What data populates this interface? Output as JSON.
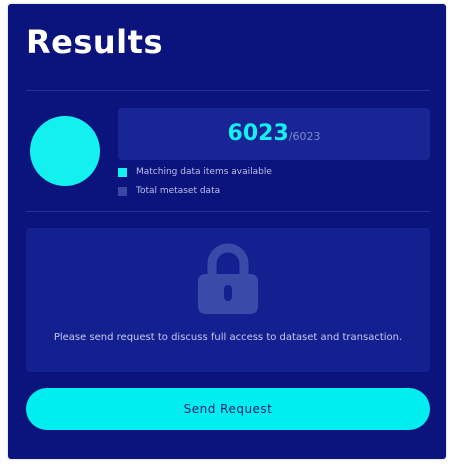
{
  "title": "Results",
  "summary": {
    "matching": 6023,
    "total": 6023,
    "matching_display": "6023",
    "separator": "/",
    "total_display": "6023"
  },
  "legend": [
    {
      "label": "Matching data items available",
      "color": "#14f0f0"
    },
    {
      "label": "Total metaset data",
      "color": "#3a46a6"
    }
  ],
  "locked": {
    "icon": "lock-icon",
    "message": "Please send request to discuss full access to dataset and transaction."
  },
  "actions": {
    "send_request_label": "Send Request"
  },
  "colors": {
    "card_bg": "#0b137c",
    "panel_bg": "#192595",
    "accent": "#00eef0",
    "lock": "#3a4aa8"
  }
}
